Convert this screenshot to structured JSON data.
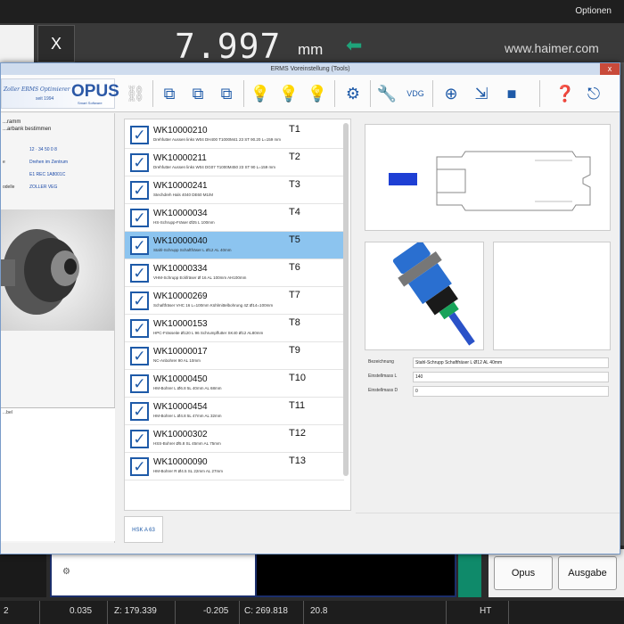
{
  "app": {
    "menu_label": "Optionen",
    "close_label": "X",
    "readout_value": "7.997",
    "readout_unit": "mm",
    "url": "www.haimer.com"
  },
  "dialog": {
    "title": "ERMS Voreinstellung (Tools)",
    "close_glyph": "x",
    "logo": {
      "script": "Zoller ERMS Optimierer",
      "sub": "seit 1994",
      "brand": "OPUS",
      "tag": "Smart Software"
    },
    "toolbar_icons": [
      "link-broken-icon",
      "tool-list-icon-1",
      "tool-list-icon-2",
      "tool-list-icon-3",
      "bulb-doc-icon-1",
      "bulb-doc-icon-2",
      "bulb-doc-icon-3",
      "settings-target-icon",
      "wrench-icon",
      "vdg-icon",
      "measure-icon",
      "import-icon",
      "3d-cube-icon",
      "help-icon",
      "exit-icon"
    ],
    "left_panel": {
      "heading": "...ramm",
      "subheading": "...arbank bestimmen",
      "kv": [
        {
          "k": "",
          "v": "12 · 34 50 0 8"
        },
        {
          "k": "e",
          "v": "Drehen im Zentrum"
        },
        {
          "k": "",
          "v": "E1 REC 1A8001C"
        },
        {
          "k": "odelle",
          "v": "ZOLLER VEG"
        }
      ],
      "note_label": "...bel"
    },
    "tools": [
      {
        "code": "WK10000210",
        "desc": "Drehfutter Aussen links W04 DH400 T1000M41 23 ST 90.20 L=159 mm",
        "t": "T1",
        "selected": false
      },
      {
        "code": "WK10000211",
        "desc": "Drehfutter Aussen links W04 DG07 T1000M450 23 ST 90 L=159 mm",
        "t": "T2",
        "selected": false
      },
      {
        "code": "WK10000241",
        "desc": "Stechdreh Hals 4040 DE60 M1/M",
        "t": "T3",
        "selected": false
      },
      {
        "code": "WK10000034",
        "desc": "HS-Schrupp-Fräser Ø25 L 100mm",
        "t": "T4",
        "selected": false
      },
      {
        "code": "WK10000040",
        "desc": "Stahl-Schrupp Schaftfräser L Ø12 AL 40mm",
        "t": "T5",
        "selected": true
      },
      {
        "code": "WK10000334",
        "desc": "VHM-Schrupp Eckfräser Ø 16 AL 100mm AH100mm",
        "t": "T6",
        "selected": false
      },
      {
        "code": "WK10000269",
        "desc": "Schaftfräser VHC 16 L=100mm Kühlmittelbohrung 4Z Ø14=100mm",
        "t": "T7",
        "selected": false
      },
      {
        "code": "WK10000153",
        "desc": "HPC-Frässeite Ø120 L 96 Schrumpffutter SK40 Ø12 AL80mm",
        "t": "T8",
        "selected": false
      },
      {
        "code": "WK10000017",
        "desc": "NC-Anbohrer 90 AL 10mm",
        "t": "T9",
        "selected": false
      },
      {
        "code": "WK10000450",
        "desc": "HM-Bohrer L Ø6.8 5L 40mm AL 68mm",
        "t": "T10",
        "selected": false
      },
      {
        "code": "WK10000454",
        "desc": "HM-Bohrer L Ø4.8 5L 47mm AL 32mm",
        "t": "T11",
        "selected": false
      },
      {
        "code": "WK10000302",
        "desc": "HSS-Bohrer Ø5.8 SL 45mm AL 75mm",
        "t": "T12",
        "selected": false
      },
      {
        "code": "WK10000090",
        "desc": "HM-Bohrer R Ø4.5 SL 22mm AL 27mm",
        "t": "T13",
        "selected": false
      }
    ],
    "holder": "HSK A 63",
    "properties": [
      {
        "k": "Bezeichnung",
        "v": "Stahl-Schrupp Schaftfräser L Ø12 AL 40mm"
      },
      {
        "k": "Einstellmass L",
        "v": "140"
      },
      {
        "k": "Einstellmass D",
        "v": "0"
      }
    ]
  },
  "bottom": {
    "btn_opus": "Opus",
    "btn_ausgabe": "Ausgabe"
  },
  "status": {
    "c0": "2",
    "c1": "0.035",
    "c2": "Z: 179.339",
    "c3": "-0.205",
    "c4": "C: 269.818",
    "c5": "20.8",
    "c6": "HT"
  },
  "colors": {
    "accent": "#1e5aa8",
    "selected_row": "#8cc4ef",
    "arrow": "#1fa37a"
  }
}
